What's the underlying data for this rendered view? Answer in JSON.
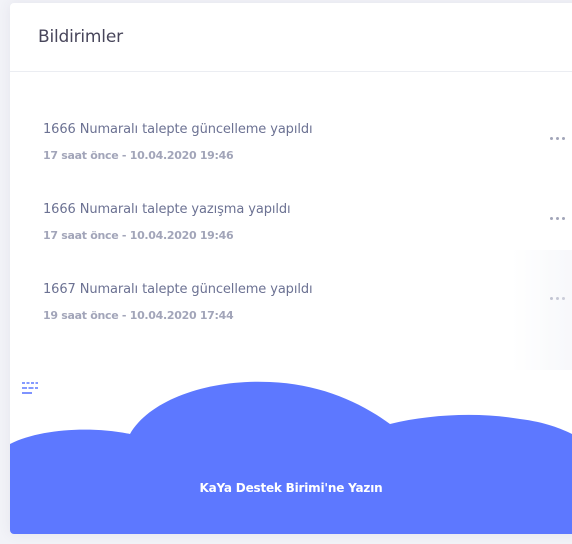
{
  "header": {
    "title": "Bildirimler"
  },
  "notifications": [
    {
      "text": "1666 Numaralı talepte güncelleme yapıldı",
      "time": "17 saat önce - 10.04.2020 19:46",
      "icon": "more-horizontal-icon"
    },
    {
      "text": "1666 Numaralı talepte yazışma yapıldı",
      "time": "17 saat önce - 10.04.2020 19:46",
      "icon": "more-horizontal-icon"
    },
    {
      "text": "1667 Numaralı talepte güncelleme yapıldı",
      "time": "19 saat önce - 10.04.2020 17:44",
      "icon": "more-horizontal-icon"
    }
  ],
  "footer": {
    "link_label": "KaYa Destek Birimi'ne Yazın",
    "icon": "envelope-icon"
  },
  "colors": {
    "accent": "#5d78ff",
    "title": "#48465b",
    "text": "#6c7293",
    "muted": "#a2a5b9"
  }
}
